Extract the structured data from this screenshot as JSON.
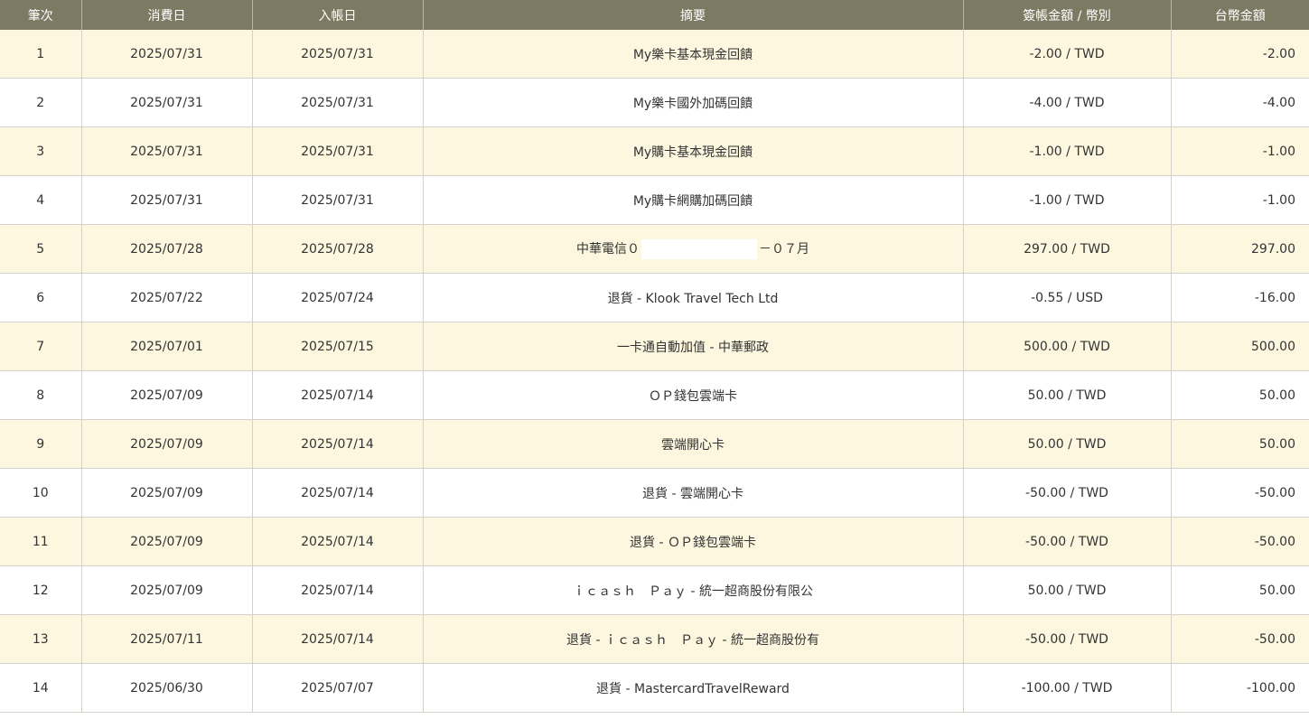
{
  "headers": {
    "seq": "筆次",
    "txn_date": "消費日",
    "post_date": "入帳日",
    "desc": "摘要",
    "amount_ccy": "簽帳金額 / 幣別",
    "twd_amount": "台幣金額"
  },
  "rows": [
    {
      "seq": "1",
      "txn_date": "2025/07/31",
      "post_date": "2025/07/31",
      "desc": "My樂卡基本現金回饋",
      "amount_ccy": "-2.00 / TWD",
      "twd_amount": "-2.00"
    },
    {
      "seq": "2",
      "txn_date": "2025/07/31",
      "post_date": "2025/07/31",
      "desc": "My樂卡國外加碼回饋",
      "amount_ccy": "-4.00 / TWD",
      "twd_amount": "-4.00"
    },
    {
      "seq": "3",
      "txn_date": "2025/07/31",
      "post_date": "2025/07/31",
      "desc": "My購卡基本現金回饋",
      "amount_ccy": "-1.00 / TWD",
      "twd_amount": "-1.00"
    },
    {
      "seq": "4",
      "txn_date": "2025/07/31",
      "post_date": "2025/07/31",
      "desc": "My購卡網購加碼回饋",
      "amount_ccy": "-1.00 / TWD",
      "twd_amount": "-1.00"
    },
    {
      "seq": "5",
      "txn_date": "2025/07/28",
      "post_date": "2025/07/28",
      "desc_prefix": "中華電信０",
      "desc_suffix": "－０７月",
      "amount_ccy": "297.00 / TWD",
      "twd_amount": "297.00"
    },
    {
      "seq": "6",
      "txn_date": "2025/07/22",
      "post_date": "2025/07/24",
      "desc": "退貨 - Klook Travel Tech Ltd",
      "amount_ccy": "-0.55 / USD",
      "twd_amount": "-16.00"
    },
    {
      "seq": "7",
      "txn_date": "2025/07/01",
      "post_date": "2025/07/15",
      "desc": "一卡通自動加值 - 中華郵政",
      "amount_ccy": "500.00 / TWD",
      "twd_amount": "500.00"
    },
    {
      "seq": "8",
      "txn_date": "2025/07/09",
      "post_date": "2025/07/14",
      "desc": "ＯＰ錢包雲端卡",
      "amount_ccy": "50.00 / TWD",
      "twd_amount": "50.00"
    },
    {
      "seq": "9",
      "txn_date": "2025/07/09",
      "post_date": "2025/07/14",
      "desc": "雲端開心卡",
      "amount_ccy": "50.00 / TWD",
      "twd_amount": "50.00"
    },
    {
      "seq": "10",
      "txn_date": "2025/07/09",
      "post_date": "2025/07/14",
      "desc": "退貨 - 雲端開心卡",
      "amount_ccy": "-50.00 / TWD",
      "twd_amount": "-50.00"
    },
    {
      "seq": "11",
      "txn_date": "2025/07/09",
      "post_date": "2025/07/14",
      "desc": "退貨 - ＯＰ錢包雲端卡",
      "amount_ccy": "-50.00 / TWD",
      "twd_amount": "-50.00"
    },
    {
      "seq": "12",
      "txn_date": "2025/07/09",
      "post_date": "2025/07/14",
      "desc": "ｉｃａｓｈ　Ｐａｙ - 統一超商股份有限公",
      "amount_ccy": "50.00 / TWD",
      "twd_amount": "50.00"
    },
    {
      "seq": "13",
      "txn_date": "2025/07/11",
      "post_date": "2025/07/14",
      "desc": "退貨 - ｉｃａｓｈ　Ｐａｙ - 統一超商股份有",
      "amount_ccy": "-50.00 / TWD",
      "twd_amount": "-50.00"
    },
    {
      "seq": "14",
      "txn_date": "2025/06/30",
      "post_date": "2025/07/07",
      "desc": "退貨 - MastercardTravelReward",
      "amount_ccy": "-100.00 / TWD",
      "twd_amount": "-100.00"
    }
  ]
}
